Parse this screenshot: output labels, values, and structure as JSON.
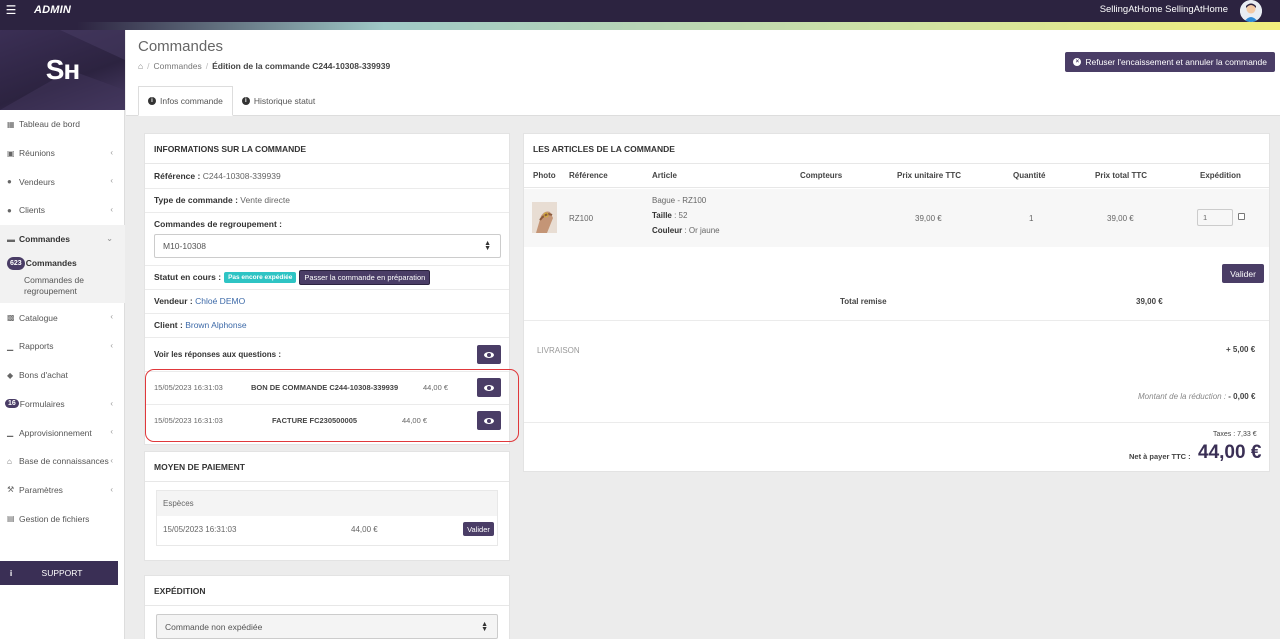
{
  "topbar": {
    "brand": "ADMIN",
    "user_name": "SellingAtHome SellingAtHome"
  },
  "sidebar": {
    "logo_text": "Sʜ",
    "items": [
      {
        "label": "Tableau de bord",
        "icon": "dashboard-icon"
      },
      {
        "label": "Réunions",
        "icon": "calendar-icon"
      },
      {
        "label": "Vendeurs",
        "icon": "users-icon"
      },
      {
        "label": "Clients",
        "icon": "users-icon"
      },
      {
        "label": "Commandes",
        "icon": "credit-card-icon"
      },
      {
        "label": "Catalogue",
        "icon": "book-icon"
      },
      {
        "label": "Rapports",
        "icon": "chart-icon"
      },
      {
        "label": "Bons d'achat",
        "icon": "tag-icon"
      },
      {
        "label": "Formulaires",
        "icon": "form-icon"
      },
      {
        "label": "Approvisionnement",
        "icon": "chart-icon"
      },
      {
        "label": "Base de connaissances",
        "icon": "home-icon"
      },
      {
        "label": "Paramètres",
        "icon": "wrench-icon"
      },
      {
        "label": "Gestion de fichiers",
        "icon": "folder-icon"
      }
    ],
    "sub_commandes": "Commandes",
    "sub_commandes_badge": "623",
    "sub_regroupement": "Commandes de regroupement",
    "formulaires_badge": "16",
    "support": "SUPPORT"
  },
  "header": {
    "title": "Commandes",
    "breadcrumb": [
      "Commandes",
      "Édition de la commande C244-10308-339939"
    ],
    "cancel_button": "Refuser l'encaissement et annuler la commande",
    "tabs": [
      "Infos commande",
      "Historique statut"
    ]
  },
  "order_info": {
    "heading": "INFORMATIONS SUR LA COMMANDE",
    "reference_label": "Référence :",
    "reference": "C244-10308-339939",
    "type_label": "Type de commande :",
    "type": "Vente directe",
    "regroupement_label": "Commandes de regroupement :",
    "regroupement_value": "M10-10308",
    "status_label": "Statut en cours :",
    "status_badge": "Pas encore expédiée",
    "status_action": "Passer la commande en préparation",
    "vendeur_label": "Vendeur :",
    "vendeur": "Chloé DEMO",
    "client_label": "Client :",
    "client": "Brown Alphonse",
    "answers_label": "Voir les réponses aux questions :",
    "documents": [
      {
        "date": "15/05/2023 16:31:03",
        "name": "BON DE COMMANDE C244-10308-339939",
        "amount": "44,00 €"
      },
      {
        "date": "15/05/2023 16:31:03",
        "name": "FACTURE FC230500005",
        "amount": "44,00 €"
      }
    ]
  },
  "payment": {
    "heading": "MOYEN DE PAIEMENT",
    "method": "Espèces",
    "date": "15/05/2023 16:31:03",
    "amount": "44,00 €",
    "button": "Valider"
  },
  "shipping": {
    "heading": "EXPÉDITION",
    "select_value": "Commande non expédiée"
  },
  "articles": {
    "heading": "LES ARTICLES DE LA COMMANDE",
    "columns": [
      "Photo",
      "Référence",
      "Article",
      "Compteurs",
      "Prix unitaire TTC",
      "Quantité",
      "Prix total TTC",
      "Expédition"
    ],
    "rows": [
      {
        "reference": "RZ100",
        "article": "Bague - RZ100",
        "taille_label": "Taille",
        "taille": ": 52",
        "couleur_label": "Couleur",
        "couleur": ": Or jaune",
        "unit_price": "39,00 €",
        "quantity": "1",
        "total": "39,00 €",
        "qty_input": "1"
      }
    ],
    "validate_button": "Valider",
    "total_remise_label": "Total remise",
    "total_remise": "39,00 €",
    "livraison_label": "LIVRAISON",
    "livraison": "+ 5,00 €",
    "reduction_label": "Montant de la réduction :",
    "reduction": "- 0,00 €",
    "taxes": "Taxes : 7,33 €",
    "net_label": "Net à payer TTC :",
    "net": "44,00 €"
  }
}
